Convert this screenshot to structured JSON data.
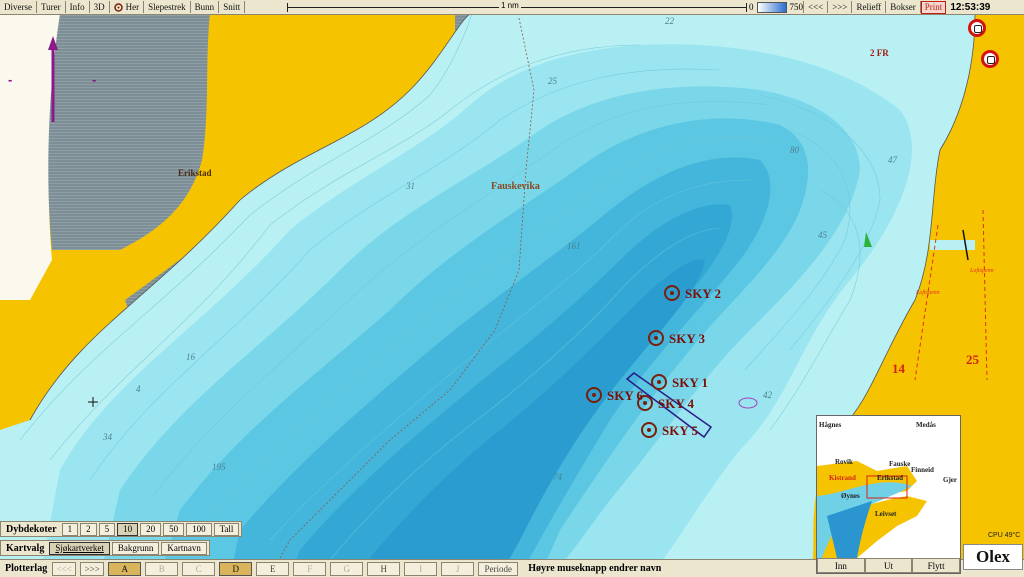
{
  "toolbar": {
    "buttons": [
      "Diverse",
      "Turer",
      "Info",
      "3D",
      "Her",
      "Slepestrek",
      "Bunn",
      "Snitt"
    ],
    "scale_label": "1 nm",
    "depth_min": "0",
    "depth_max": "750",
    "nav_prev": "<<<",
    "nav_next": ">>>",
    "relief": "Relieff",
    "boxes": "Bokser",
    "print": "Print",
    "clock": "12:53:39"
  },
  "colors": {
    "land": "#f6c300",
    "shallow_water": "#b7f0f4",
    "deep_water": "#2f9fd3",
    "mudflat": "#6d7f88",
    "marker_red": "#d42315"
  },
  "map": {
    "places": [
      {
        "text": "Erikstad"
      },
      {
        "text": "Fauskevika"
      },
      {
        "text": "2 FR"
      }
    ],
    "depths": [
      "22",
      "25",
      "31",
      "16",
      "4",
      "34",
      "195",
      "161",
      "80",
      "47",
      "45",
      "42",
      "74"
    ],
    "red_numbers": [
      "14",
      "25"
    ],
    "small_red_labels": [
      "Loftspenn",
      "Loftspenn"
    ],
    "markers": [
      {
        "label": "SKY 2"
      },
      {
        "label": "SKY 3"
      },
      {
        "label": "SKY 1"
      },
      {
        "label": "SKY 6"
      },
      {
        "label": "SKY 4"
      },
      {
        "label": "SKY 5"
      }
    ],
    "minus_labels": [
      "-",
      "-"
    ],
    "plus_label": "+"
  },
  "depth_panel": {
    "label": "Dybdekoter",
    "options": [
      "1",
      "2",
      "5",
      "10",
      "20",
      "50",
      "100",
      "Tall"
    ],
    "selected": "10"
  },
  "chart_panel": {
    "label": "Kartvalg",
    "options": [
      "Sjøkartverket",
      "Bakgrunn",
      "Kartnavn"
    ],
    "selected": "Sjøkartverket"
  },
  "bottom_bar": {
    "label": "Plotterlag",
    "prev": "<<<",
    "next": ">>>",
    "layers": [
      "A",
      "B",
      "C",
      "D",
      "E",
      "F",
      "G",
      "H",
      "I",
      "J"
    ],
    "dim_layers": [
      "B",
      "C",
      "F",
      "G",
      "I",
      "J"
    ],
    "selected_layers": [
      "A",
      "D"
    ],
    "period": "Periode",
    "hint": "Høyre museknapp endrer navn"
  },
  "minimap": {
    "labels": [
      "Hågnes",
      "Medås",
      "Rovik",
      "Fauske",
      "Finneid",
      "Gjer",
      "Erikstad",
      "Øynes",
      "Leivset",
      "Kistrand"
    ],
    "buttons": [
      "Inn",
      "Ut",
      "Flytt"
    ]
  },
  "status": {
    "cpu": "CPU 49°C",
    "logo": "Olex"
  }
}
